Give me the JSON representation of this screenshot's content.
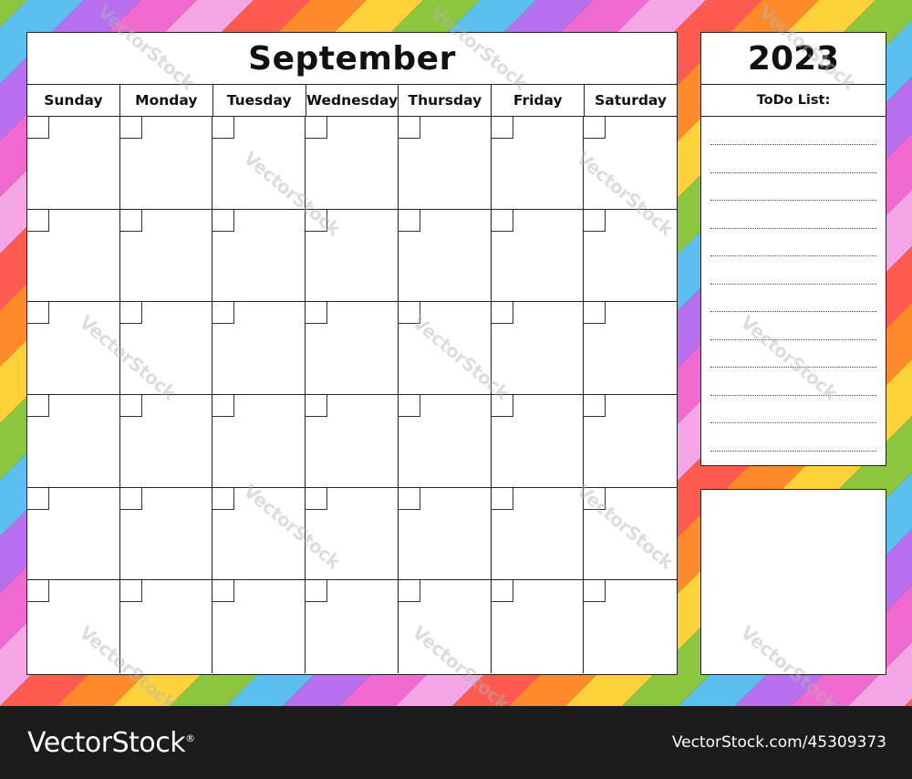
{
  "calendar": {
    "month": "September",
    "weekdays": [
      "Sunday",
      "Monday",
      "Tuesday",
      "Wednesday",
      "Thursday",
      "Friday",
      "Saturday"
    ],
    "weeks": 6
  },
  "year_panel": {
    "year": "2023",
    "todo_title": "ToDo List:",
    "todo_line_count": 12
  },
  "notes_panel": {
    "content": ""
  },
  "background": {
    "stripe_colors": [
      "#ff5a4f",
      "#ff8a2a",
      "#ffd23a",
      "#8cc63f",
      "#5bc0f0",
      "#b970f0",
      "#f06ad0",
      "#f4a6e6"
    ]
  },
  "watermark": {
    "text": "VectorStock"
  },
  "footer": {
    "brand": "VectorStock",
    "registered_mark": "®",
    "image_id": "VectorStock.com/45309373"
  }
}
